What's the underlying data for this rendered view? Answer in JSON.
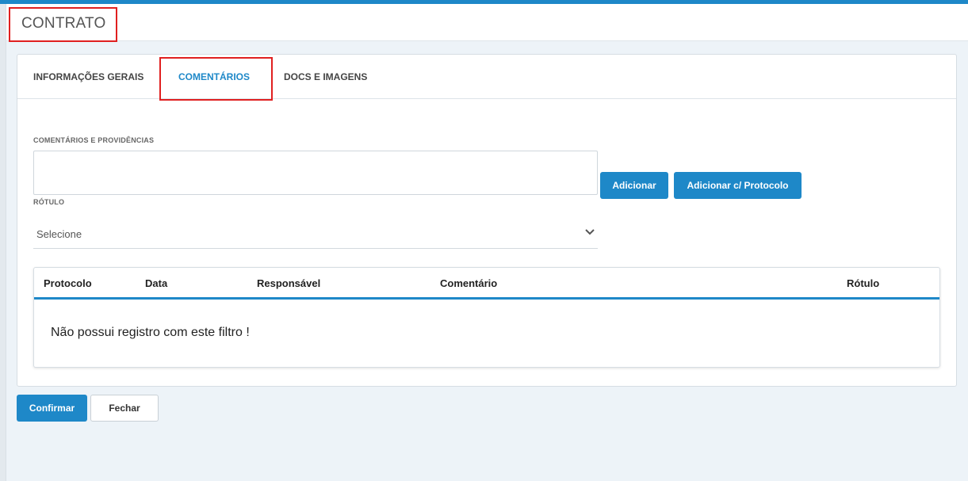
{
  "header": {
    "title": "CONTRATO"
  },
  "tabs": [
    {
      "label": "INFORMAÇÕES GERAIS",
      "active": false
    },
    {
      "label": "COMENTÁRIOS",
      "active": true
    },
    {
      "label": "DOCS E IMAGENS",
      "active": false
    }
  ],
  "form": {
    "comments_label": "COMENTÁRIOS E PROVIDÊNCIAS",
    "comments_value": "",
    "add_label": "Adicionar",
    "add_protocol_label": "Adicionar c/ Protocolo",
    "rotulo_label": "RÓTULO",
    "rotulo_value": "Selecione"
  },
  "table": {
    "columns": [
      "Protocolo",
      "Data",
      "Responsável",
      "Comentário",
      "Rótulo"
    ],
    "empty_message": "Não possui registro com este filtro !"
  },
  "footer": {
    "confirm_label": "Confirmar",
    "close_label": "Fechar"
  },
  "colors": {
    "accent": "#1e88c8",
    "highlight_border": "#e02020",
    "background": "#edf3f8"
  }
}
